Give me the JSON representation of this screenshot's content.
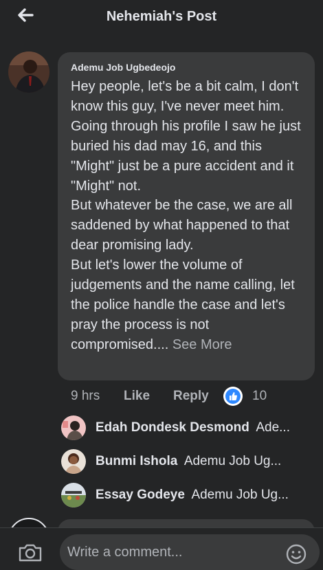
{
  "header": {
    "title": "Nehemiah's Post"
  },
  "comment": {
    "author": "Ademu Job Ugbedeojo",
    "paragraphs": [
      "Hey people,  let's be a bit calm, I don't know this guy,  I've never meet him.",
      "Going through his profile I saw he just buried his dad may 16, and this \"Might\" just be a pure accident and it \"Might\" not.",
      "But whatever be the case,  we are all saddened by what happened to that dear promising lady.",
      "But let's lower the volume of judgements and the name calling, let the police handle the case and let's pray the process is not compromised...."
    ],
    "see_more": "See More",
    "time": "9 hrs",
    "like_label": "Like",
    "reply_label": "Reply",
    "reaction_count": "10",
    "reaction_icon": "thumbs-up-icon",
    "accent": "#2d88ff"
  },
  "replies": [
    {
      "name": "Edah Dondesk Desmond",
      "preview": "Ade..."
    },
    {
      "name": "Bunmi Ishola",
      "preview": "Ademu Job Ug..."
    },
    {
      "name": "Essay Godeye",
      "preview": "Ademu Job Ug..."
    }
  ],
  "composer": {
    "placeholder": "Write a comment...",
    "camera_icon": "camera-icon",
    "emoji_icon": "emoji-icon"
  },
  "colors": {
    "background": "#242526",
    "bubble": "#3a3b3c",
    "text": "#e4e6eb",
    "secondary": "#b0b3b8"
  }
}
